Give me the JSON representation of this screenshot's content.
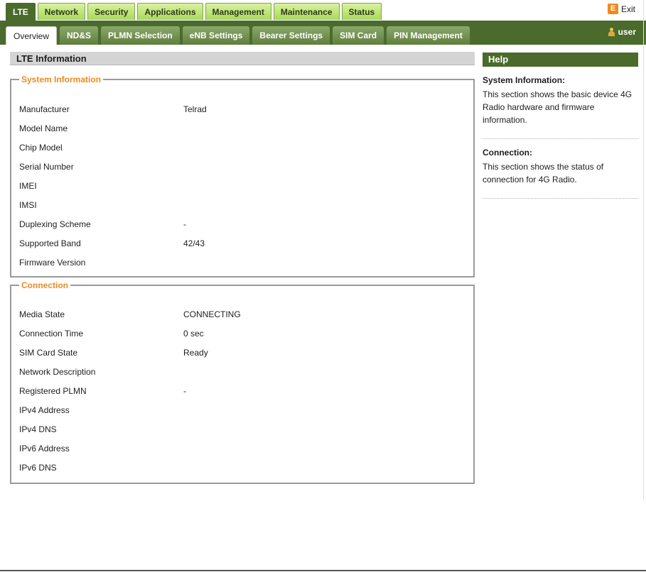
{
  "top_tabs": [
    "LTE",
    "Network",
    "Security",
    "Applications",
    "Management",
    "Maintenance",
    "Status"
  ],
  "exit_label": "Exit",
  "sub_tabs": [
    "Overview",
    "ND&S",
    "PLMN Selection",
    "eNB Settings",
    "Bearer Settings",
    "SIM Card",
    "PIN Management"
  ],
  "user_label": "user",
  "section_title": "LTE Information",
  "system_info": {
    "legend": "System Information",
    "rows": [
      {
        "label": "Manufacturer",
        "value": "Telrad"
      },
      {
        "label": "Model Name",
        "value": ""
      },
      {
        "label": "Chip Model",
        "value": ""
      },
      {
        "label": "Serial Number",
        "value": ""
      },
      {
        "label": "IMEI",
        "value": ""
      },
      {
        "label": "IMSI",
        "value": ""
      },
      {
        "label": "Duplexing Scheme",
        "value": "-"
      },
      {
        "label": "Supported Band",
        "value": "42/43"
      },
      {
        "label": "Firmware Version",
        "value": ""
      }
    ]
  },
  "connection": {
    "legend": "Connection",
    "rows": [
      {
        "label": "Media State",
        "value": "CONNECTING"
      },
      {
        "label": "Connection Time",
        "value": "0 sec"
      },
      {
        "label": "SIM Card State",
        "value": "Ready"
      },
      {
        "label": "Network Description",
        "value": ""
      },
      {
        "label": "Registered PLMN",
        "value": "-"
      },
      {
        "label": "IPv4 Address",
        "value": ""
      },
      {
        "label": "IPv4 DNS",
        "value": ""
      },
      {
        "label": "IPv6 Address",
        "value": ""
      },
      {
        "label": "IPv6 DNS",
        "value": ""
      }
    ]
  },
  "help": {
    "title": "Help",
    "items": [
      {
        "heading": "System Information:",
        "text": "This section shows the basic device 4G Radio hardware and firmware information."
      },
      {
        "heading": "Connection:",
        "text": "This section shows the status of connection for 4G Radio."
      }
    ]
  },
  "colors": {
    "nav_green": "#4a6b2c",
    "tab_green": "#a9d85a",
    "accent_orange": "#f08a1c"
  }
}
